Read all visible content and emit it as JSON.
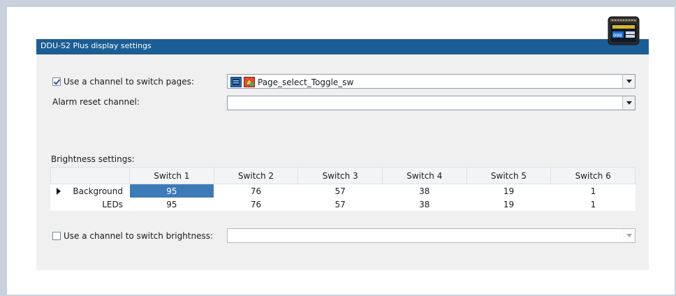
{
  "panel": {
    "title": "DDU-S2 Plus display settings"
  },
  "page_switch": {
    "checkbox_label": "Use a channel to switch pages:",
    "checked": true,
    "selected_channel": "Page_select_Toggle_sw"
  },
  "alarm_reset": {
    "label": "Alarm reset channel:",
    "value": ""
  },
  "brightness": {
    "label": "Brightness settings:",
    "columns": [
      "Switch 1",
      "Switch 2",
      "Switch 3",
      "Switch 4",
      "Switch 5",
      "Switch 6"
    ],
    "rows": [
      {
        "name": "Background",
        "values": [
          "95",
          "76",
          "57",
          "38",
          "19",
          "1"
        ]
      },
      {
        "name": "LEDs",
        "values": [
          "95",
          "76",
          "57",
          "38",
          "19",
          "1"
        ]
      }
    ]
  },
  "brightness_switch": {
    "checkbox_label": "Use a channel to switch brightness:",
    "checked": false,
    "value": ""
  },
  "icons": {
    "device": "ddu-display-icon",
    "channel": "channel-icon",
    "math": "math-channel-icon",
    "row_pointer": "row-pointer-icon"
  },
  "colors": {
    "header": "#1b5e95",
    "selection": "#3d7ab8"
  }
}
